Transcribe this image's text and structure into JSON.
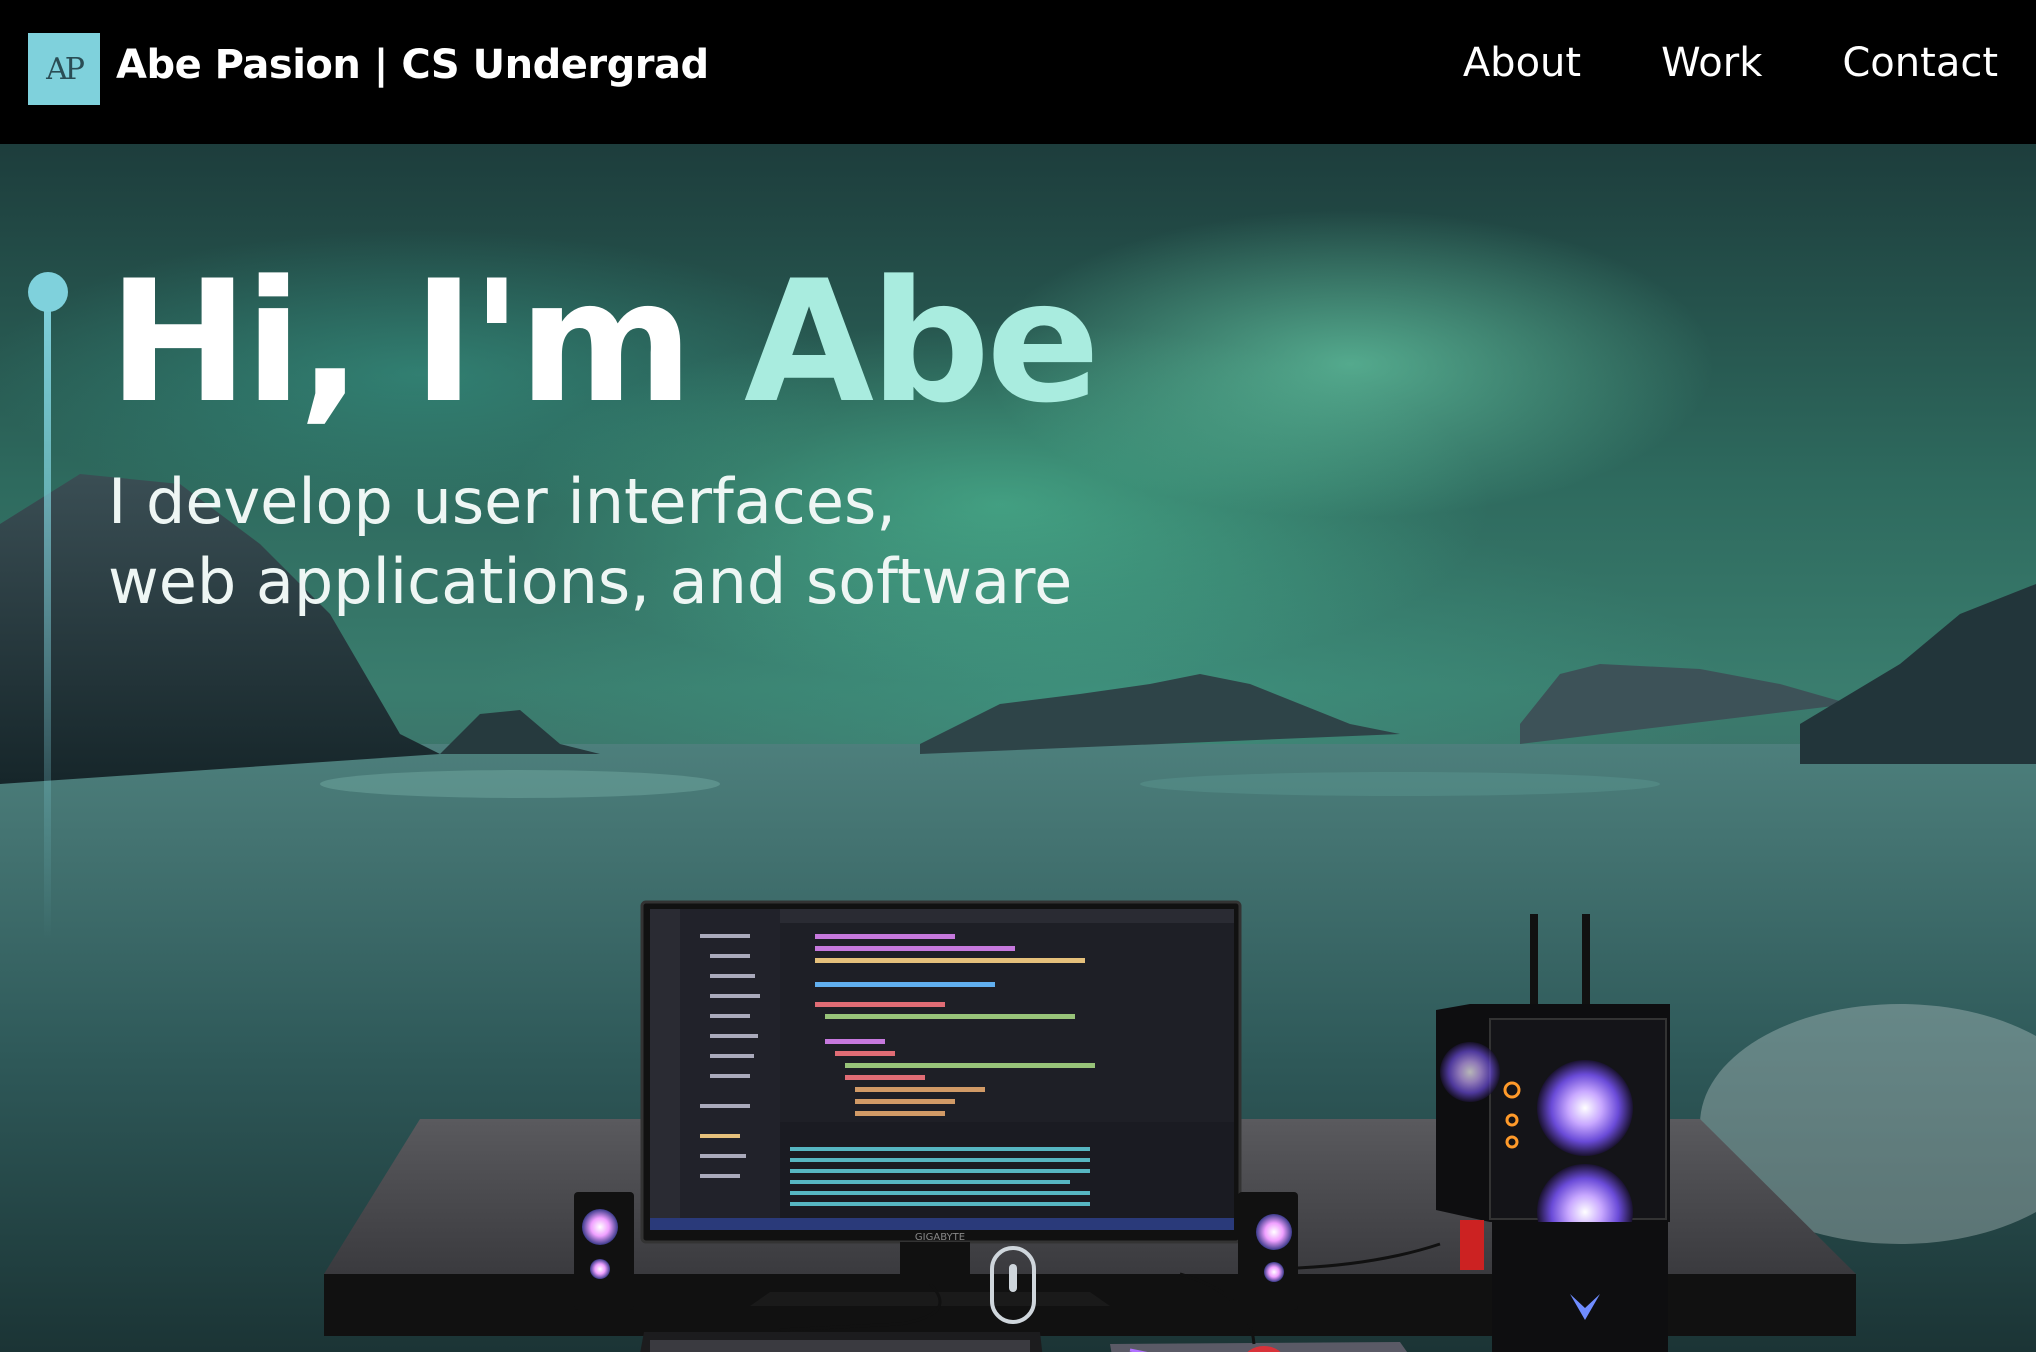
{
  "navbar": {
    "logo_text": "AP",
    "brand": "Abe Pasion  | CS Undergrad",
    "links": [
      "About",
      "Work",
      "Contact"
    ]
  },
  "hero": {
    "title_prefix": "Hi, I'm ",
    "title_accent": "Abe",
    "subtitle_line1": "I develop user interfaces,",
    "subtitle_line2": "web applications, and software"
  },
  "monitor": {
    "brand": "GIGABYTE"
  },
  "colors": {
    "accent": "#7fd1dc",
    "title_accent": "#a9ecdf",
    "background": "#000000"
  }
}
